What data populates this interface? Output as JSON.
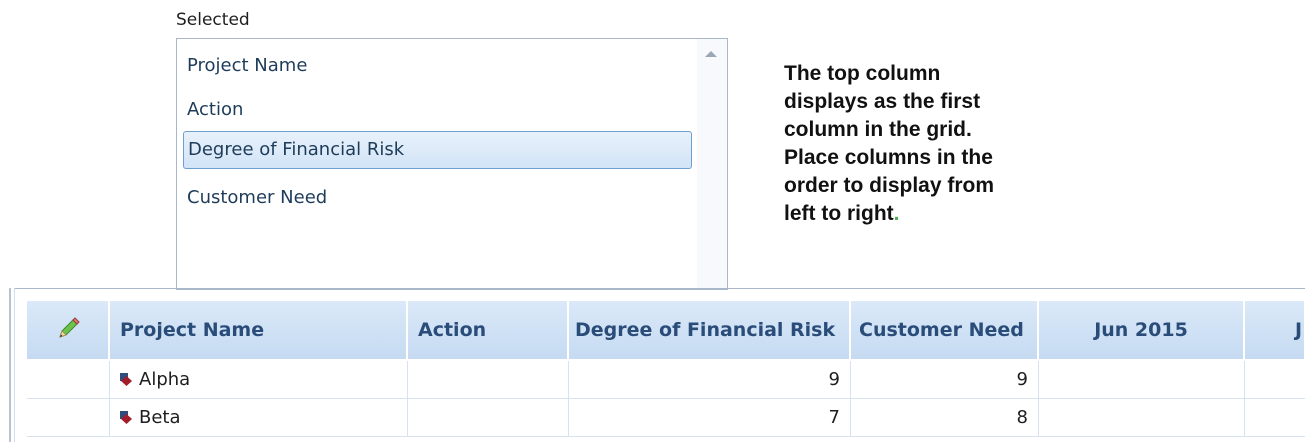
{
  "selected_panel": {
    "label": "Selected",
    "items": [
      {
        "label": "Project Name",
        "selected": false
      },
      {
        "label": "Action",
        "selected": false
      },
      {
        "label": "Degree of Financial Risk",
        "selected": true
      },
      {
        "label": "Customer Need",
        "selected": false
      }
    ]
  },
  "help_text": {
    "body": "The top column\ndisplays as the first\ncolumn  in the grid.\nPlace columns in the\norder to display from\nleft to right",
    "end_mark": "."
  },
  "grid": {
    "columns": [
      "",
      "Project Name",
      "Action",
      "Degree of Financial Risk",
      "Customer Need",
      "Jun 2015",
      "J"
    ],
    "rows": [
      {
        "project": "Alpha",
        "action": "",
        "financial_risk": "9",
        "customer_need": "9",
        "jun_2015": ""
      },
      {
        "project": "Beta",
        "action": "",
        "financial_risk": "7",
        "customer_need": "8",
        "jun_2015": ""
      }
    ]
  },
  "colors": {
    "header_bg": "#c5daf2",
    "header_text": "#2a4c79",
    "selection_border": "#6e9fd3",
    "project_icon": "#a31e2b"
  }
}
